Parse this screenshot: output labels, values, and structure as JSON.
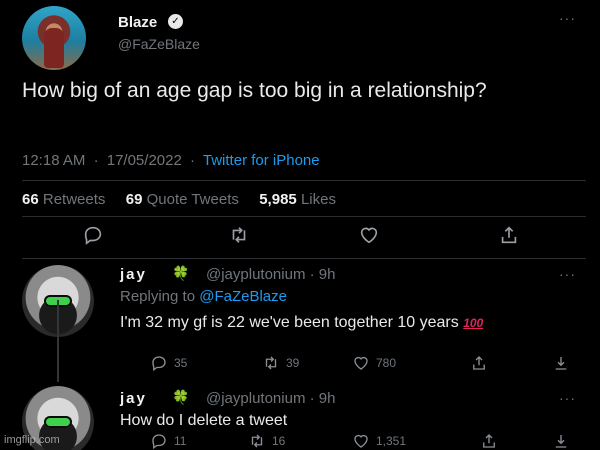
{
  "tweet": {
    "display_name": "Blaze",
    "verified_badge": "✓",
    "handle": "@FaZeBlaze",
    "text": "How big of an age gap is too big in a relationship?",
    "time": "12:18 AM",
    "date": "17/05/2022",
    "separator": "·",
    "source": "Twitter for iPhone",
    "stats": {
      "retweets_count": "66",
      "retweets_label": "Retweets",
      "quotes_count": "69",
      "quotes_label": "Quote Tweets",
      "likes_count": "5,985",
      "likes_label": "Likes"
    },
    "more": "···"
  },
  "replies": [
    {
      "name": "jay",
      "clover": "🍀",
      "handle": "@jayplutonium",
      "age": "· 9h",
      "replying_prefix": "Replying to",
      "replying_handle": "@FaZeBlaze",
      "text": "I'm 32 my gf is 22 we've been together 10 years",
      "emoji": "100",
      "counts": {
        "replies": "35",
        "retweets": "39",
        "likes": "780"
      },
      "more": "···"
    },
    {
      "name": "jay",
      "clover": "🍀",
      "handle": "@jayplutonium",
      "age": "· 9h",
      "text": "How do I delete a tweet",
      "counts": {
        "replies": "11",
        "retweets": "16",
        "likes": "1,351"
      },
      "more": "···"
    }
  ],
  "watermark": "imgflip.com",
  "icons": [
    "reply-icon",
    "retweet-icon",
    "like-icon",
    "share-icon",
    "download-icon",
    "more-icon",
    "verified-icon",
    "clover-icon"
  ],
  "colors": {
    "background": "#000000",
    "text": "#e7e9ea",
    "secondary": "#71767b",
    "link": "#1d9bf0",
    "clover": "#3fb950"
  }
}
